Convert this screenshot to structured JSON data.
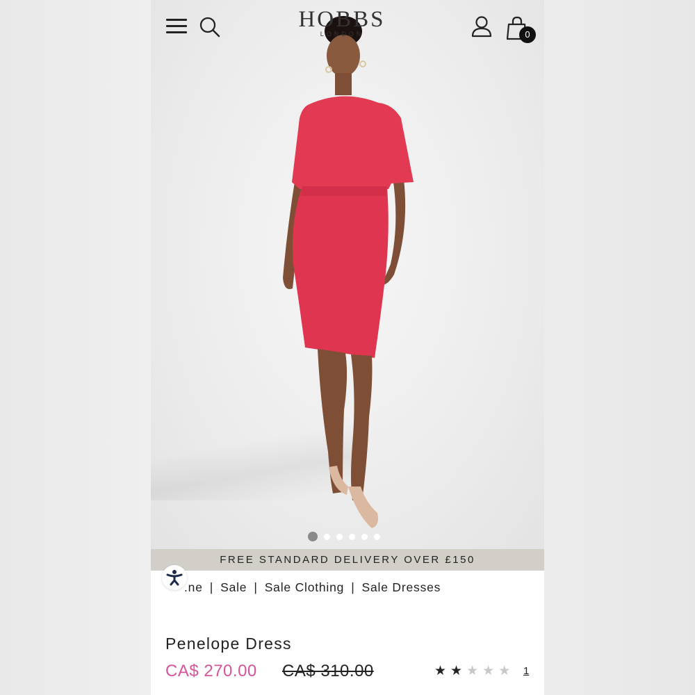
{
  "header": {
    "logo_main": "HOBBS",
    "logo_sub": "LONDON",
    "bag_count": "0",
    "icons": [
      "menu-icon",
      "search-icon",
      "account-icon",
      "shopping-bag-icon"
    ]
  },
  "carousel": {
    "total_slides": 6,
    "active_index": 0
  },
  "promo": {
    "text": "FREE STANDARD DELIVERY OVER £150"
  },
  "breadcrumb": {
    "items": [
      ".ne",
      "Sale",
      "Sale Clothing",
      "Sale Dresses"
    ],
    "separator": "|"
  },
  "product": {
    "name": "Penelope Dress",
    "sale_price": "CA$ 270.00",
    "original_price": "CA$ 310.00",
    "rating": 2,
    "rating_max": 5,
    "review_count": "1"
  },
  "colors": {
    "sale_price": "#d6559a",
    "promo_bg": "#d2cfc9",
    "dress": "#e0354d"
  }
}
